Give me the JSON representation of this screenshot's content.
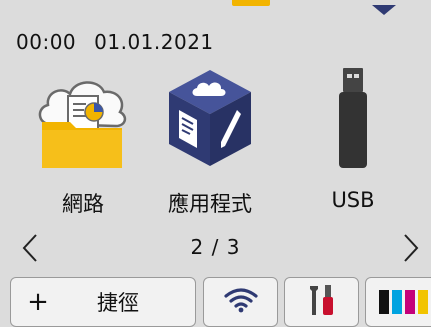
{
  "status": {
    "time": "00:00",
    "date": "01.01.2021"
  },
  "apps": [
    {
      "label": "網路",
      "icon": "network-folder-cloud-icon"
    },
    {
      "label": "應用程式",
      "icon": "apps-cube-icon"
    },
    {
      "label": "USB",
      "icon": "usb-drive-icon"
    }
  ],
  "pager": {
    "current": "2 / 3",
    "prev_icon": "chevron-left-icon",
    "next_icon": "chevron-right-icon"
  },
  "bottom_bar": {
    "shortcut_plus": "+",
    "shortcut_label": "捷徑",
    "wifi_icon": "wifi-icon",
    "tools_icon": "tools-icon",
    "ink_icon": "ink-levels-icon"
  },
  "colors": {
    "folder_yellow": "#f2b400",
    "cube_blue": "#2f3a73",
    "ink_black": "#111111",
    "ink_cyan": "#00a3e0",
    "ink_magenta": "#c4007a",
    "ink_yellow": "#f2c400",
    "tool_red": "#c8102e"
  }
}
